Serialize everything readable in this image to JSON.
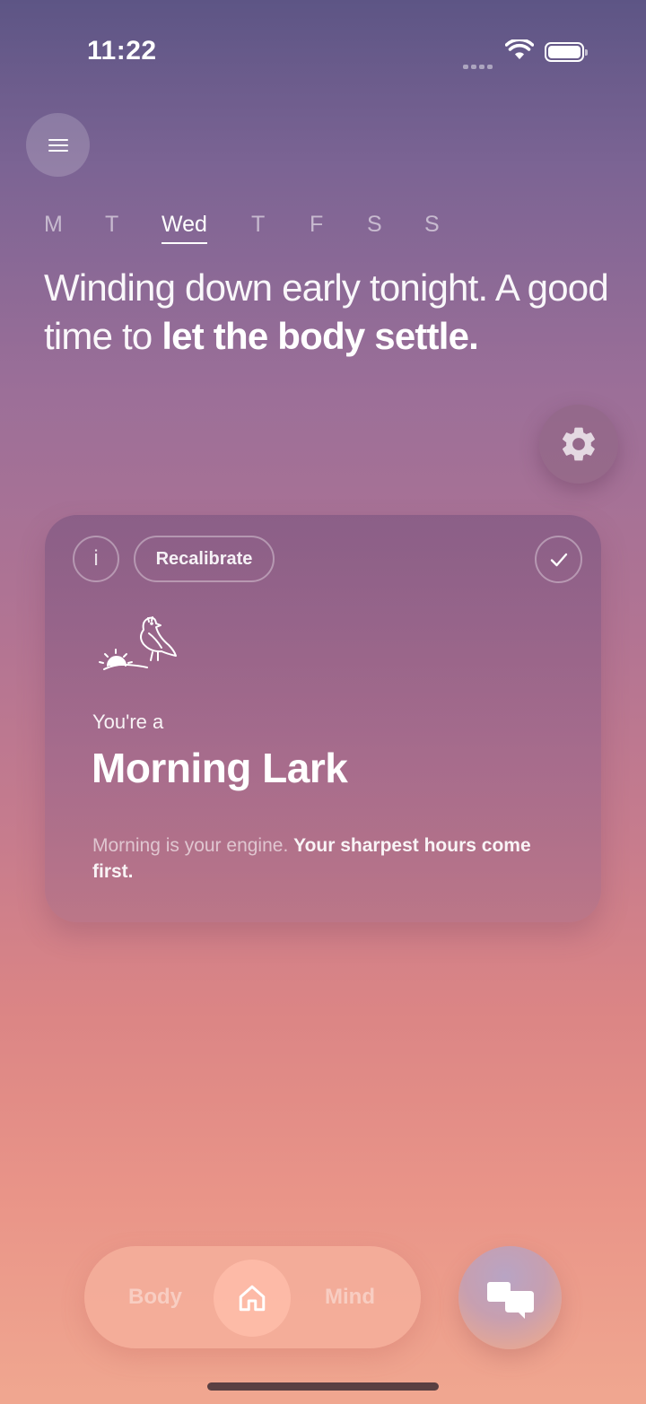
{
  "status_bar": {
    "time": "11:22"
  },
  "week": {
    "days": [
      "M",
      "T",
      "Wed",
      "T",
      "F",
      "S",
      "S"
    ],
    "selected_index": 2
  },
  "headline": {
    "text_plain": "Winding down early tonight. A good time to ",
    "text_bold": "let the body settle."
  },
  "card": {
    "info_label": "i",
    "recalibrate_label": "Recalibrate",
    "subtitle": "You're a",
    "title": "Morning Lark",
    "desc_plain": "Morning is your engine. ",
    "desc_bold": "Your sharpest hours come first."
  },
  "nav": {
    "body_label": "Body",
    "mind_label": "Mind"
  },
  "icons": {
    "menu": "hamburger-icon",
    "settings": "gear-icon",
    "lark": "bird-sunrise-icon",
    "check": "checkmark-icon",
    "home": "home-icon",
    "chat": "chat-bubbles-icon"
  }
}
